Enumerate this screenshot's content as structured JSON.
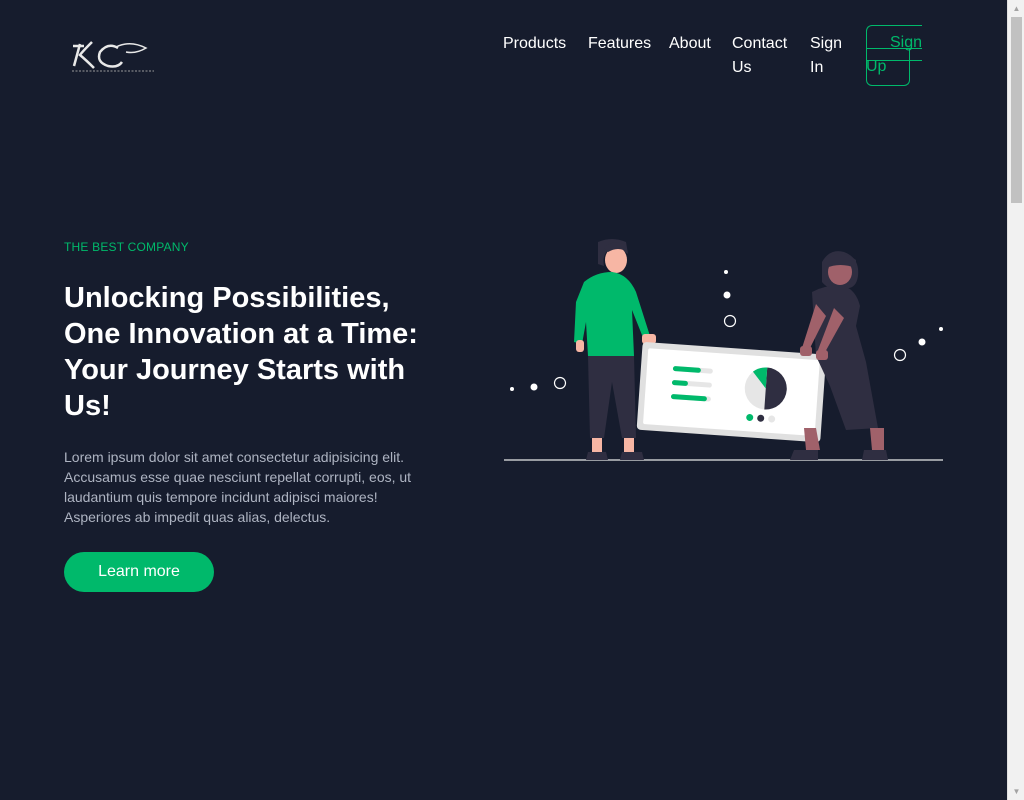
{
  "header": {
    "nav_items": [
      {
        "line1": "Products",
        "line2": ""
      },
      {
        "line1": "Features",
        "line2": ""
      },
      {
        "line1": "About",
        "line2": ""
      },
      {
        "line1": "Contact",
        "line2": "Us"
      },
      {
        "line1": "Sign",
        "line2": "In"
      }
    ],
    "signup": {
      "line1": "Sign",
      "line2": "Up"
    }
  },
  "hero": {
    "eyebrow": "THE BEST COMPANY",
    "headline": "Unlocking Possibilities, One Innovation at a Time: Your Journey Starts with Us!",
    "body": "Lorem ipsum dolor sit amet consectetur adipisicing elit. Accusamus esse quae nesciunt repellat corrupti, eos, ut laudantium quis tempore incidunt adipisci maiores! Asperiores ab impedit quas alias, delectus.",
    "cta_label": "Learn more"
  },
  "colors": {
    "background": "#161c2d",
    "accent": "#00b96b",
    "muted_text": "#aeb4c2"
  },
  "icons": [
    "logo-mark",
    "scroll-up-arrow",
    "scroll-down-arrow"
  ]
}
